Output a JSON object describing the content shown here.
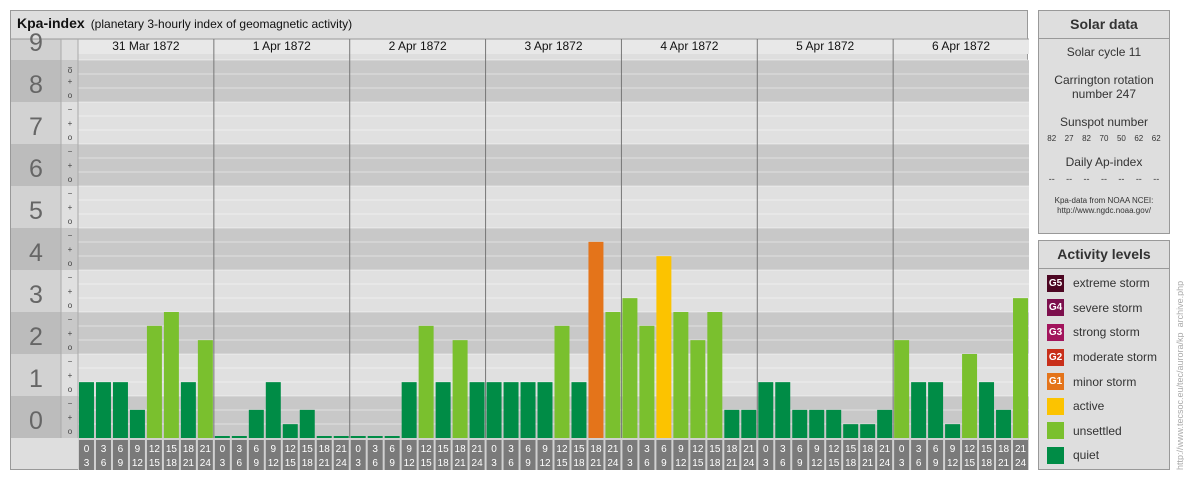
{
  "header": {
    "title": "Kpa-index",
    "subtitle": "(planetary 3-hourly index of geomagnetic activity)"
  },
  "colors": {
    "quiet": "#008c46",
    "unsettled": "#7ac02e",
    "active": "#fcc300",
    "minor_storm": "#e4741a",
    "moderate_storm": "#c82f1a",
    "strong_storm": "#a2145c",
    "severe_storm": "#7c0f4d",
    "extreme_storm": "#4c0622"
  },
  "chart_data": {
    "type": "bar",
    "title": "Kpa-index",
    "subtitle": "(planetary 3-hourly index of geomagnetic activity)",
    "ylim": [
      0,
      9
    ],
    "y_major_ticks": [
      "0",
      "1",
      "2",
      "3",
      "4",
      "5",
      "6",
      "7",
      "8",
      "9"
    ],
    "y_minor_ticks": [
      "o",
      "+",
      "−"
    ],
    "days": [
      "31 Mar 1872",
      "1 Apr 1872",
      "2 Apr 1872",
      "3 Apr 1872",
      "4 Apr 1872",
      "5 Apr 1872",
      "6 Apr 1872"
    ],
    "interval_start": [
      "0",
      "3",
      "6",
      "9",
      "12",
      "15",
      "18",
      "21"
    ],
    "interval_end": [
      "3",
      "6",
      "9",
      "12",
      "15",
      "18",
      "21",
      "24"
    ],
    "values": [
      [
        1.33,
        1.33,
        1.33,
        0.67,
        2.67,
        3.0,
        1.33,
        2.33
      ],
      [
        0.0,
        0.0,
        0.67,
        1.33,
        0.33,
        0.67,
        0.0,
        0.0
      ],
      [
        0.0,
        0.0,
        0.0,
        1.33,
        2.67,
        1.33,
        2.33,
        1.33
      ],
      [
        1.33,
        1.33,
        1.33,
        1.33,
        2.67,
        1.33,
        4.67,
        3.0
      ],
      [
        3.33,
        2.67,
        4.33,
        3.0,
        2.33,
        3.0,
        0.67,
        0.67
      ],
      [
        1.33,
        1.33,
        0.67,
        0.67,
        0.67,
        0.33,
        0.33,
        0.67
      ],
      [
        2.33,
        1.33,
        1.33,
        0.33,
        2.0,
        1.33,
        0.67,
        3.33
      ]
    ],
    "levels": [
      "quiet",
      "quiet",
      "quiet",
      "quiet",
      "unsettled",
      "unsettled",
      "quiet",
      "unsettled",
      "quiet",
      "quiet",
      "quiet",
      "quiet",
      "quiet",
      "quiet",
      "quiet",
      "quiet",
      "quiet",
      "quiet",
      "quiet",
      "quiet",
      "unsettled",
      "quiet",
      "unsettled",
      "quiet",
      "quiet",
      "quiet",
      "quiet",
      "quiet",
      "unsettled",
      "quiet",
      "minor_storm",
      "unsettled",
      "unsettled",
      "unsettled",
      "active",
      "unsettled",
      "unsettled",
      "unsettled",
      "quiet",
      "quiet",
      "quiet",
      "quiet",
      "quiet",
      "quiet",
      "quiet",
      "quiet",
      "quiet",
      "quiet",
      "unsettled",
      "quiet",
      "quiet",
      "quiet",
      "unsettled",
      "quiet",
      "quiet",
      "unsettled"
    ]
  },
  "solar": {
    "title": "Solar data",
    "cycle": "Solar cycle 11",
    "carrington_1": "Carrington rotation",
    "carrington_2": "number 247",
    "sunspot_title": "Sunspot number",
    "sunspots": [
      "82",
      "27",
      "82",
      "70",
      "50",
      "62",
      "62"
    ],
    "ap_title": "Daily Ap-index",
    "ap": [
      "--",
      "--",
      "--",
      "--",
      "--",
      "--",
      "--"
    ],
    "source_1": "Kpa-data from NOAA NCEI:",
    "source_2": "http://www.ngdc.noaa.gov/"
  },
  "levels": {
    "title": "Activity levels",
    "items": [
      {
        "badge": "G5",
        "label": "extreme storm",
        "color": "#4c0622"
      },
      {
        "badge": "G4",
        "label": "severe storm",
        "color": "#7c0f4d"
      },
      {
        "badge": "G3",
        "label": "strong storm",
        "color": "#a2145c"
      },
      {
        "badge": "G2",
        "label": "moderate storm",
        "color": "#c82f1a"
      },
      {
        "badge": "G1",
        "label": "minor storm",
        "color": "#e4741a"
      },
      {
        "badge": "",
        "label": "active",
        "color": "#fcc300"
      },
      {
        "badge": "",
        "label": "unsettled",
        "color": "#7ac02e"
      },
      {
        "badge": "",
        "label": "quiet",
        "color": "#008c46"
      }
    ]
  },
  "credit": "http://www.tecsoc.eu/tec/aurora/kp_archive.php"
}
